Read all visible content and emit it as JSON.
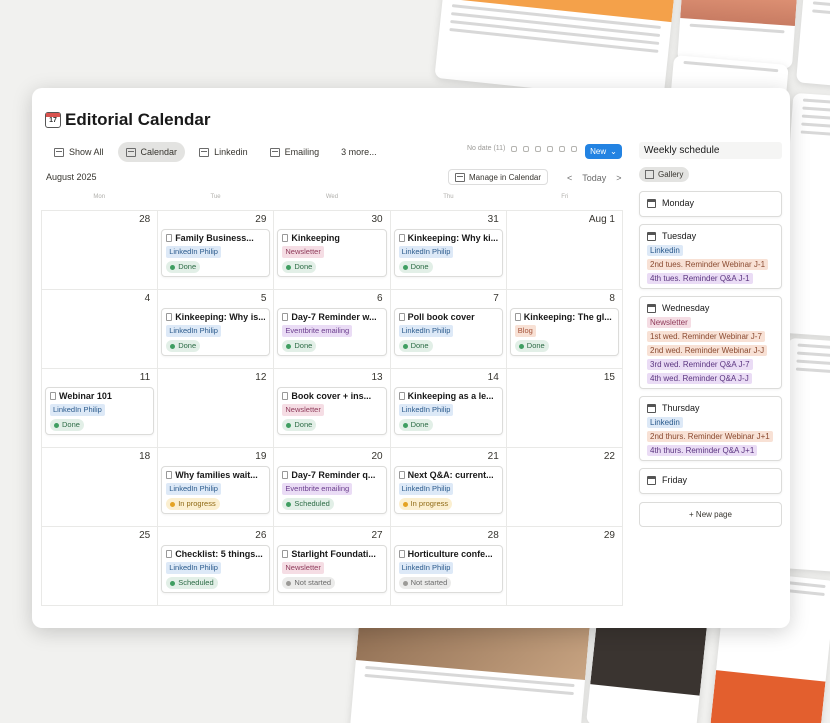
{
  "window": {
    "title": "Editorial Calendar",
    "calendar_emoji_day": "17"
  },
  "tabs": [
    {
      "label": "Show All"
    },
    {
      "label": "Calendar"
    },
    {
      "label": "Linkedin"
    },
    {
      "label": "Emailing"
    },
    {
      "label": "3 more..."
    }
  ],
  "toolbar": {
    "no_date": "No date (11)",
    "new_label": "New",
    "manage_label": "Manage in Calendar",
    "today_label": "Today",
    "prev": "<",
    "next": ">"
  },
  "calendar": {
    "month": "August 2025",
    "weekdays": [
      "Mon",
      "Tue",
      "Wed",
      "Thu",
      "Fri"
    ],
    "days": [
      {
        "num": "28"
      },
      {
        "num": "29",
        "title": "Family Business...",
        "tag": "LinkedIn Philip",
        "tagclass": "t-li",
        "status": "Done",
        "sclass": "s-done"
      },
      {
        "num": "30",
        "title": "Kinkeeping",
        "tag": "Newsletter",
        "tagclass": "t-nl",
        "status": "Done",
        "sclass": "s-done"
      },
      {
        "num": "31",
        "title": "Kinkeeping: Why ki...",
        "tag": "LinkedIn Philip",
        "tagclass": "t-li",
        "status": "Done",
        "sclass": "s-done"
      },
      {
        "num": "Aug 1"
      },
      {
        "num": "4"
      },
      {
        "num": "5",
        "title": "Kinkeeping: Why is...",
        "tag": "LinkedIn Philip",
        "tagclass": "t-li",
        "status": "Done",
        "sclass": "s-done"
      },
      {
        "num": "6",
        "title": "Day-7 Reminder w...",
        "tag": "Eventbrite emailing",
        "tagclass": "t-eb",
        "status": "Done",
        "sclass": "s-done"
      },
      {
        "num": "7",
        "title": "Poll book cover",
        "tag": "LinkedIn Philip",
        "tagclass": "t-li",
        "status": "Done",
        "sclass": "s-done"
      },
      {
        "num": "8",
        "title": "Kinkeeping: The gl...",
        "tag": "Blog",
        "tagclass": "t-bl",
        "status": "Done",
        "sclass": "s-done"
      },
      {
        "num": "11",
        "title": "Webinar 101",
        "tag": "LinkedIn Philip",
        "tagclass": "t-li",
        "status": "Done",
        "sclass": "s-done"
      },
      {
        "num": "12"
      },
      {
        "num": "13",
        "title": "Book cover + ins...",
        "tag": "Newsletter",
        "tagclass": "t-nl",
        "status": "Done",
        "sclass": "s-done"
      },
      {
        "num": "14",
        "title": "Kinkeeping as a le...",
        "tag": "LinkedIn Philip",
        "tagclass": "t-li",
        "status": "Done",
        "sclass": "s-done"
      },
      {
        "num": "15"
      },
      {
        "num": "18"
      },
      {
        "num": "19",
        "title": "Why families wait...",
        "tag": "LinkedIn Philip",
        "tagclass": "t-li",
        "status": "In progress",
        "sclass": "s-prog"
      },
      {
        "num": "20",
        "title": "Day-7 Reminder q...",
        "tag": "Eventbrite emailing",
        "tagclass": "t-eb",
        "status": "Scheduled",
        "sclass": "s-sch"
      },
      {
        "num": "21",
        "title": "Next Q&A: current...",
        "tag": "LinkedIn Philip",
        "tagclass": "t-li",
        "status": "In progress",
        "sclass": "s-prog"
      },
      {
        "num": "22"
      },
      {
        "num": "25"
      },
      {
        "num": "26",
        "title": "Checklist: 5 things...",
        "tag": "LinkedIn Philip",
        "tagclass": "t-li",
        "status": "Scheduled",
        "sclass": "s-sch"
      },
      {
        "num": "27",
        "title": "Starlight Foundati...",
        "tag": "Newsletter",
        "tagclass": "t-nl",
        "status": "Not started",
        "sclass": "s-ns"
      },
      {
        "num": "28",
        "title": "Horticulture confe...",
        "tag": "LinkedIn Philip",
        "tagclass": "t-li",
        "status": "Not started",
        "sclass": "s-ns"
      },
      {
        "num": "29"
      }
    ]
  },
  "side": {
    "title": "Weekly schedule",
    "gallery_label": "Gallery",
    "new_page_label": "+ New page",
    "days": [
      {
        "name": "Monday",
        "tags": []
      },
      {
        "name": "Tuesday",
        "tags": [
          {
            "text": "Linkedin",
            "cls": "t-li"
          },
          {
            "text": "2nd tues. Reminder Webinar J-1",
            "cls": "t-or"
          },
          {
            "text": "4th tues. Reminder Q&A J-1",
            "cls": "t-pu"
          }
        ]
      },
      {
        "name": "Wednesday",
        "tags": [
          {
            "text": "Newsletter",
            "cls": "t-nl"
          },
          {
            "text": "1st wed. Reminder Webinar J-7",
            "cls": "t-or"
          },
          {
            "text": "2nd wed. Reminder Webinar J-J",
            "cls": "t-or"
          },
          {
            "text": "3rd wed. Reminder Q&A J-7",
            "cls": "t-pu"
          },
          {
            "text": "4th wed. Reminder Q&A J-J",
            "cls": "t-pu"
          }
        ]
      },
      {
        "name": "Thursday",
        "tags": [
          {
            "text": "Linkedin",
            "cls": "t-li"
          },
          {
            "text": "2nd thurs. Reminder Webinar J+1",
            "cls": "t-or"
          },
          {
            "text": "4th thurs. Reminder Q&A J+1",
            "cls": "t-pu"
          }
        ]
      },
      {
        "name": "Friday",
        "tags": []
      }
    ]
  }
}
